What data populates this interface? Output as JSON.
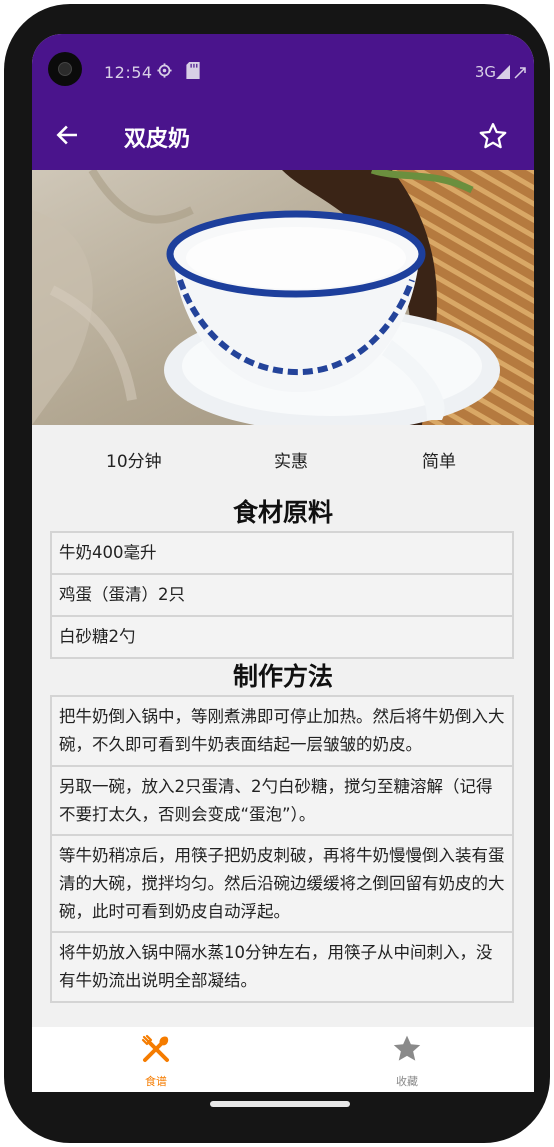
{
  "status_bar": {
    "time": "12:54",
    "network": "3G"
  },
  "app_bar": {
    "title": "双皮奶"
  },
  "recipe": {
    "time": "10分钟",
    "cost": "实惠",
    "difficulty": "简单"
  },
  "ingredients": {
    "title": "食材原料",
    "items": [
      "牛奶400毫升",
      "鸡蛋（蛋清）2只",
      "白砂糖2勺"
    ]
  },
  "method": {
    "title": "制作方法",
    "steps": [
      "把牛奶倒入锅中，等刚煮沸即可停止加热。然后将牛奶倒入大碗，不久即可看到牛奶表面结起一层皱皱的奶皮。",
      "另取一碗，放入2只蛋清、2勺白砂糖，搅匀至糖溶解（记得不要打太久，否则会变成“蛋泡”）。",
      "等牛奶稍凉后，用筷子把奶皮刺破，再将牛奶慢慢倒入装有蛋清的大碗，搅拌均匀。然后沿碗边缓缓将之倒回留有奶皮的大碗，此时可看到奶皮自动浮起。",
      "将牛奶放入锅中隔水蒸10分钟左右，用筷子从中间刺入，没有牛奶流出说明全部凝结。"
    ]
  },
  "bottom_nav": {
    "items": [
      {
        "label": "食谱",
        "icon": "utensils-icon",
        "active": true
      },
      {
        "label": "收藏",
        "icon": "star-icon",
        "active": false
      }
    ]
  },
  "colors": {
    "primary": "#4a148c",
    "accent": "#f57c00",
    "inactive": "#8a8a8a"
  }
}
